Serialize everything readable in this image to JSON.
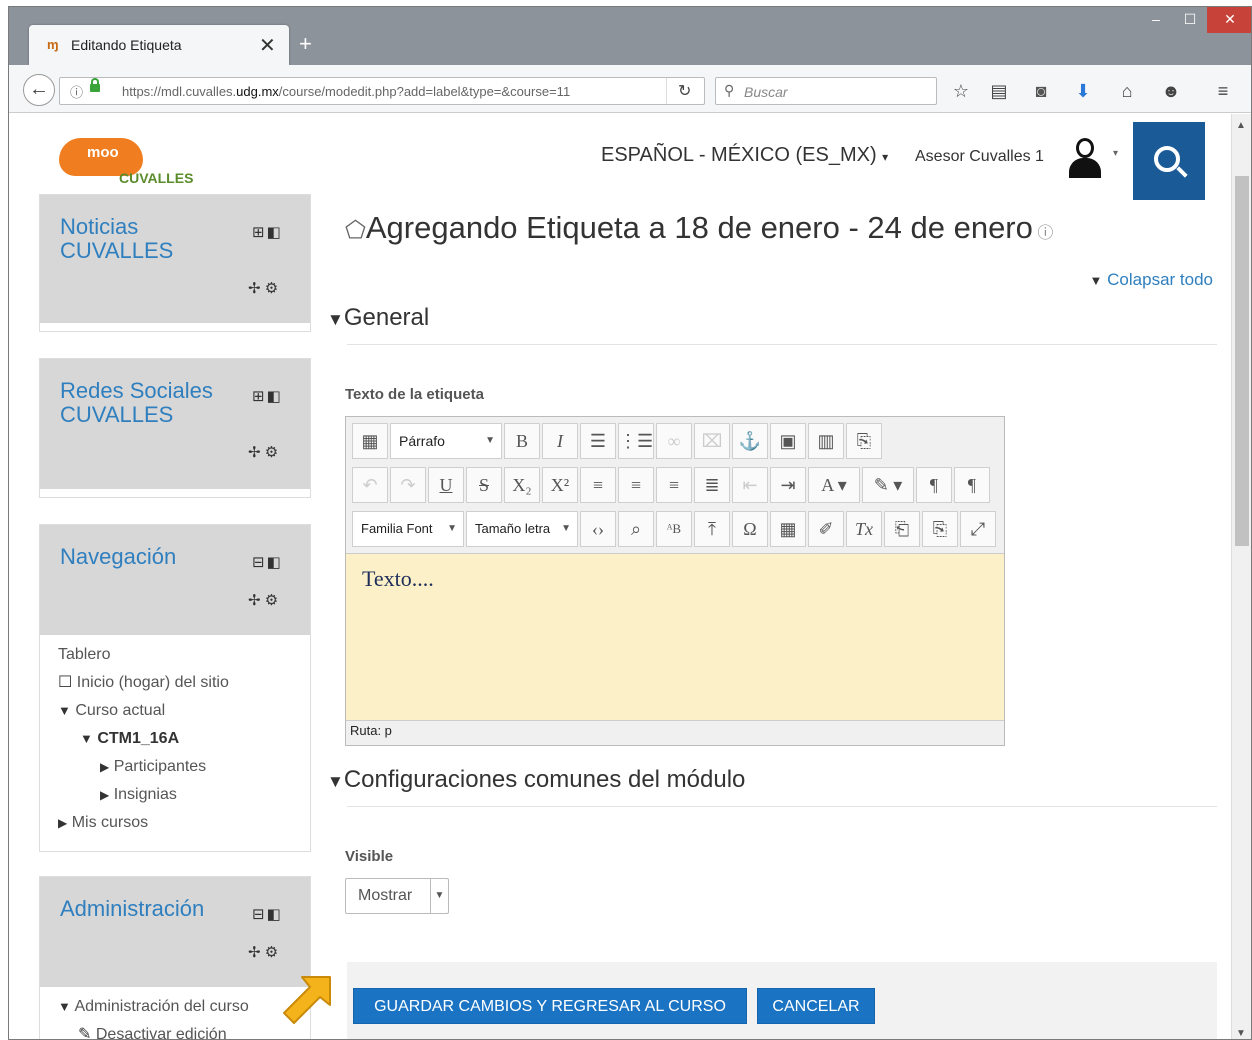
{
  "browser": {
    "tab_favicon": "ɱ",
    "tab_title": "Editando Etiqueta",
    "tab_close": "✕",
    "new_tab": "+",
    "url_prefix": "https://mdl.cuvalles.",
    "url_domain": "udg.mx",
    "url_path": "/course/modedit.php?add=label&type=&course=11",
    "search_placeholder": "Buscar",
    "window_buttons": [
      "–",
      "☐",
      "✕"
    ],
    "toolbar_icons": [
      "star-icon",
      "bookmarks-icon",
      "pocket-icon",
      "download-icon",
      "home-icon",
      "chat-icon",
      "menu-icon"
    ]
  },
  "header": {
    "logo_text": "moo",
    "logo_subtext": "CUVALLES",
    "language": "ESPAÑOL - MÉXICO (ES_MX)",
    "language_caret": "▾",
    "user_name": "Asesor Cuvalles 1",
    "user_caret": "▾"
  },
  "blocks": {
    "noticias": {
      "title": "Noticias CUVALLES"
    },
    "redes": {
      "title": "Redes Sociales CUVALLES"
    },
    "navegacion": {
      "title": "Navegación",
      "items": [
        {
          "label": "Tablero",
          "marker": ""
        },
        {
          "label": "Inicio (hogar) del sitio",
          "marker": "☐"
        },
        {
          "label": "Curso actual",
          "marker": "▼"
        },
        {
          "label": "CTM1_16A",
          "marker": "▼"
        },
        {
          "label": "Participantes",
          "marker": "▶"
        },
        {
          "label": "Insignias",
          "marker": "▶"
        },
        {
          "label": "Mis cursos",
          "marker": "▶"
        }
      ]
    },
    "administracion": {
      "title": "Administración",
      "items": [
        {
          "label": "Administración del curso",
          "marker": "▼"
        },
        {
          "label": "Desactivar edición",
          "marker": "✎"
        }
      ]
    }
  },
  "main": {
    "heading": "Agregando Etiqueta a 18 de enero - 24 de enero",
    "collapse_all": "Colapsar todo",
    "section_general": "General",
    "field_label_text": "Texto de la etiqueta",
    "editor": {
      "paragraph_select": "Párrafo",
      "font_family_select": "Familia Font",
      "font_size_select": "Tamaño letra",
      "content": "Texto....",
      "path": "Ruta: p"
    },
    "section_common": "Configuraciones comunes del módulo",
    "field_label_visible": "Visible",
    "visible_value": "Mostrar",
    "save_button": "GUARDAR CAMBIOS Y REGRESAR AL CURSO",
    "cancel_button": "CANCELAR"
  },
  "colors": {
    "brand_blue": "#1a5a96",
    "link_blue": "#2f7fbf",
    "button_blue": "#1a73c3",
    "editor_bg": "#fcf0c8",
    "arrow": "#f5b31b"
  }
}
